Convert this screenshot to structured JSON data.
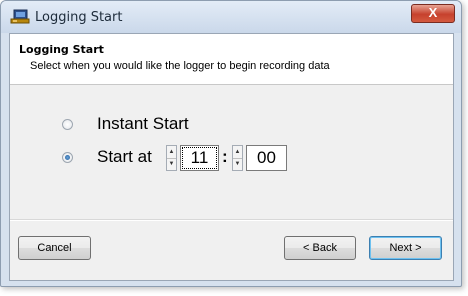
{
  "window": {
    "title": "Logging Start",
    "close_label": "X"
  },
  "header": {
    "title": "Logging Start",
    "subtitle": "Select when you would like the logger to begin recording data"
  },
  "options": [
    {
      "label": "Instant Start",
      "selected": false
    },
    {
      "label": "Start at",
      "selected": true
    }
  ],
  "time": {
    "hour": "11",
    "separator": ":",
    "minute": "00"
  },
  "footer": {
    "cancel_label": "Cancel",
    "back_label": "< Back",
    "next_label": "Next >"
  },
  "icons": {
    "app": "logger-computer-icon",
    "close": "close-icon",
    "spin_up": "chevron-up-icon",
    "spin_down": "chevron-down-icon"
  },
  "colors": {
    "close_button": "#c6412d",
    "radio_selected": "#1f5c9b",
    "default_button_border": "#3c7fb1"
  }
}
